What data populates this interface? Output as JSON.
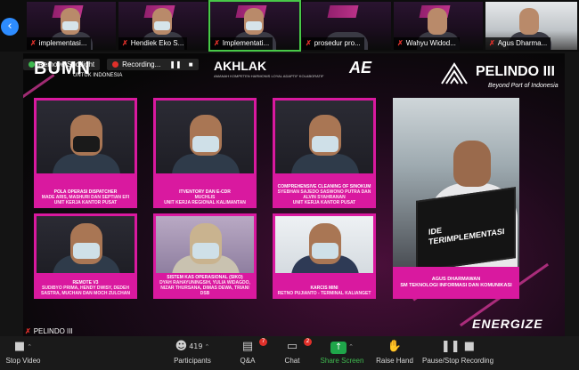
{
  "strip": {
    "nav_icon": "chevron-left-icon",
    "participants": [
      {
        "name": "implementasi...",
        "muted": true
      },
      {
        "name": "Hendiek Eko S...",
        "muted": true
      },
      {
        "name": "Implementati...",
        "muted": true,
        "active": true
      },
      {
        "name": "prosedur pro...",
        "muted": true
      },
      {
        "name": "Wahyu Widod...",
        "muted": true
      },
      {
        "name": "Agus Dharma...",
        "muted": true
      }
    ]
  },
  "sharebar": {
    "remove_spotlight": "Remove Spotlight",
    "recording": "Recording...",
    "pause_icon": "pause-icon",
    "stop_icon": "stop-icon"
  },
  "slide": {
    "bumn": "BUMN",
    "bumn_sub": "UNTUK INDONESIA",
    "akhlak": "AKHLAK",
    "akhlak_sub": "AMANAH KOMPETEN HARMONIS LOYAL ADAPTIF KOLABORATIF",
    "ae": "AE",
    "pelindo": "PELINDO III",
    "pelindo_tag": "Beyond Port of Indonesia",
    "cards": [
      {
        "title": "POLA OPERASI DISPATCHER",
        "names": "MADE ARIS, MASHURI DAN SEPTIAN EFI",
        "unit": "UNIT KERJA KANTOR PUSAT"
      },
      {
        "title": "ITVENTORY DAN E-CDR",
        "names": "MUCHLIS",
        "unit": "UNIT KERJA REGIONAL KALIMANTAN"
      },
      {
        "title": "COMPREHENSIVE CLEANING OF SINOKUM",
        "names": "SYEBHAN SAJEDO SASWONO PUTRA DAN ALVIN SYAHRANAN",
        "unit": "UNIT KERJA KANTOR PUSAT"
      },
      {
        "title": "REMOTE V3",
        "names": "SUDIBYO PRIMA, HENDY DWISY, DEDEH SASTRA, MUCHAN DAN MOCH ZULCHAN",
        "unit": ""
      },
      {
        "title": "SISTEM KAS OPERASIONAL (SIKO)",
        "names": "DYAH RAHAYUNINGSIH, YULIA WIDAGDO, NIZAR THURSANA, DIMAS DEWA, TRIANI DSB",
        "unit": ""
      },
      {
        "title": "KARCIS MINI",
        "names": "RETNO PUJIANTO - TERMINAL KALIANGET",
        "unit": ""
      }
    ],
    "featured_board": "IDE TERIMPLEMENTASI",
    "featured_name": "AGUS DHARMAWAN",
    "featured_unit": "SM TEKNOLOGI INFORMASI DAN KOMUNIKASI",
    "energize": "ENERGIZE"
  },
  "share_name": "PELINDO III",
  "toolbar": {
    "stop_video": "Stop Video",
    "participants": "Participants",
    "participants_count": "419",
    "qa": "Q&A",
    "qa_badge": "7",
    "chat": "Chat",
    "chat_badge": "2",
    "share_screen": "Share Screen",
    "raise_hand": "Raise Hand",
    "pause_recording": "Pause/Stop Recording"
  },
  "colors": {
    "accent": "#d9199f",
    "zoom_blue": "#2d8cff",
    "share_green": "#1fa64a",
    "alert_red": "#e0302a"
  }
}
